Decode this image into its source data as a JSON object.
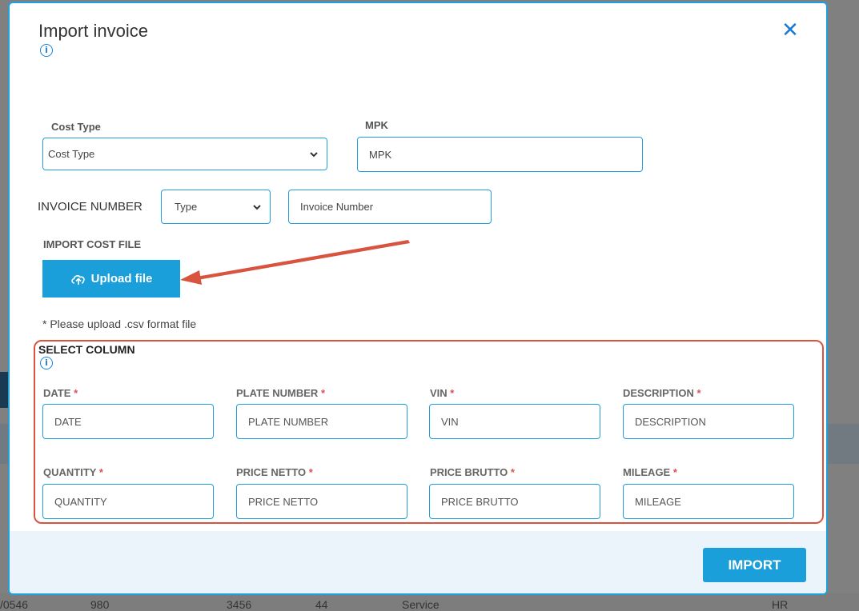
{
  "modal": {
    "title": "Import invoice",
    "close_glyph": "✕",
    "info_glyph": "i"
  },
  "cost_type": {
    "label": "Cost Type",
    "value": "Cost Type"
  },
  "mpk": {
    "label": "MPK",
    "placeholder": "MPK"
  },
  "invoice_number": {
    "label": "INVOICE NUMBER",
    "type_value": "Type",
    "placeholder": "Invoice Number"
  },
  "import_cost_file": {
    "label": "IMPORT COST FILE",
    "upload_label": "Upload file",
    "hint": "* Please upload .csv format file"
  },
  "select_column": {
    "title": "SELECT COLUMN",
    "required_mark": "*",
    "fields": [
      {
        "label": "DATE",
        "placeholder": "DATE"
      },
      {
        "label": "PLATE NUMBER",
        "placeholder": "PLATE NUMBER"
      },
      {
        "label": "VIN",
        "placeholder": "VIN"
      },
      {
        "label": "DESCRIPTION",
        "placeholder": "DESCRIPTION"
      },
      {
        "label": "QUANTITY",
        "placeholder": "QUANTITY"
      },
      {
        "label": "PRICE NETTO",
        "placeholder": "PRICE NETTO"
      },
      {
        "label": "PRICE BRUTTO",
        "placeholder": "PRICE BRUTTO"
      },
      {
        "label": "MILEAGE",
        "placeholder": "MILEAGE"
      }
    ]
  },
  "footer": {
    "import_label": "IMPORT"
  },
  "background_row": {
    "cells": [
      "/0546",
      "980",
      "3456",
      "44",
      "Service",
      "HR"
    ]
  },
  "colors": {
    "accent": "#1a9fdb",
    "annotation": "#d9543f"
  }
}
